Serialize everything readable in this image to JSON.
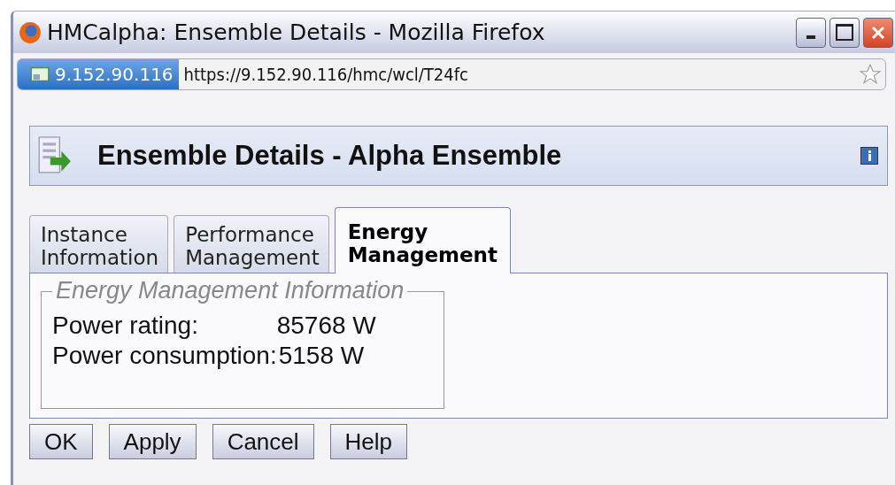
{
  "window": {
    "title": "HMCalpha: Ensemble Details - Mozilla Firefox"
  },
  "address_bar": {
    "site": "9.152.90.116",
    "url": "https://9.152.90.116/hmc/wcl/T24fc"
  },
  "header": {
    "title": "Ensemble Details - Alpha Ensemble"
  },
  "tabs": [
    {
      "label": "Instance\nInformation",
      "selected": false
    },
    {
      "label": "Performance\nManagement",
      "selected": false
    },
    {
      "label": "Energy\nManagement",
      "selected": true
    }
  ],
  "group": {
    "legend": "Energy Management Information",
    "rows": [
      {
        "label": "Power rating:",
        "value": "85768 W"
      },
      {
        "label": "Power consumption:",
        "value": "5158 W"
      }
    ]
  },
  "buttons": [
    "OK",
    "Apply",
    "Cancel",
    "Help"
  ]
}
